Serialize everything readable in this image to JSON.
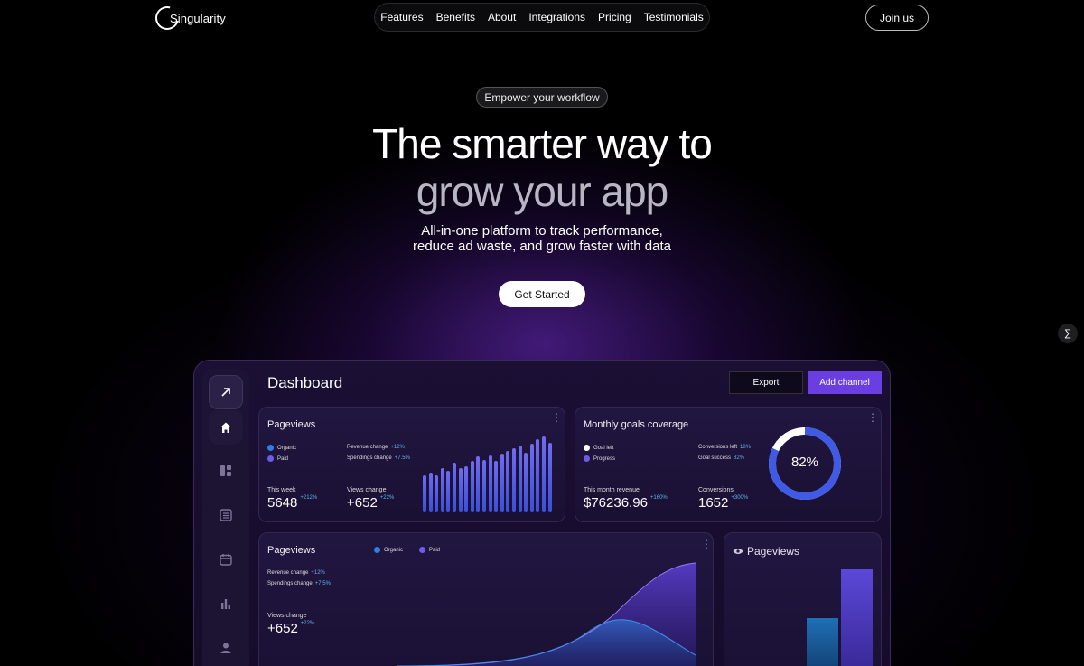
{
  "brand": {
    "name": "Singularity"
  },
  "nav": {
    "items": [
      "Features",
      "Benefits",
      "About",
      "Integrations",
      "Pricing",
      "Testimonials"
    ],
    "join_label": "Join us"
  },
  "hero": {
    "badge": "Empower your workflow",
    "title_line1": "The smarter way to",
    "title_line2": "grow your app",
    "subtitle_line1": "All-in-one platform to track performance,",
    "subtitle_line2": "reduce ad waste, and grow faster with data",
    "cta_label": "Get Started"
  },
  "framer_badge": "∑",
  "dashboard": {
    "title": "Dashboard",
    "export_label": "Export",
    "add_channel_label": "Add channel",
    "sidebar_icons": [
      "arrow-up-right-icon",
      "home-icon",
      "layout-icon",
      "table-icon",
      "calendar-icon",
      "bar-chart-icon",
      "user-icon"
    ],
    "pageviews_card": {
      "title": "Pageviews",
      "legend": [
        {
          "name": "Organic",
          "color": "#2f7fe0"
        },
        {
          "name": "Paid",
          "color": "#6c5ce7"
        }
      ],
      "revenue_change_label": "Revenue change",
      "revenue_change": "+12%",
      "spendings_change_label": "Spendings change",
      "spendings_change": "+7.5%",
      "this_week_label": "This week",
      "this_week_value": "5648",
      "this_week_change": "+212%",
      "views_change_label": "Views change",
      "views_change_value": "+652",
      "views_change_change": "+22%"
    },
    "goals_card": {
      "title": "Monthly goals coverage",
      "legend": [
        {
          "name": "Goal left",
          "color": "#ffffff"
        },
        {
          "name": "Progress",
          "color": "#6c5ce7"
        }
      ],
      "conversions_left_label": "Conversions left",
      "conversions_left": "18%",
      "goal_success_label": "Goal success",
      "goal_success": "82%",
      "revenue_label": "This month revenue",
      "revenue_value": "$76236.96",
      "revenue_change": "+160%",
      "conversions_label": "Conversions",
      "conversions_value": "1652",
      "conversions_change": "+300%",
      "donut_value": "82%",
      "donut_fraction": 0.82
    },
    "pageviews_card2": {
      "title": "Pageviews",
      "legend": [
        {
          "name": "Organic",
          "color": "#2f7fe0"
        },
        {
          "name": "Paid",
          "color": "#6c5ce7"
        }
      ],
      "revenue_change_label": "Revenue change",
      "revenue_change": "+12%",
      "spendings_change_label": "Spendings change",
      "spendings_change": "+7.5%",
      "views_change_label": "Views change",
      "views_change_value": "+652",
      "views_change_change": "+22%"
    },
    "pageviews_card3": {
      "title": "Pageviews"
    }
  },
  "chart_data": [
    {
      "type": "bar",
      "values": [
        26,
        28,
        26,
        31,
        29,
        35,
        31,
        32,
        36,
        39,
        37,
        40,
        36,
        41,
        43,
        45,
        47,
        42,
        48,
        51,
        53,
        49
      ],
      "title": "Pageviews"
    },
    {
      "type": "pie",
      "values": [
        82,
        18
      ],
      "labels": [
        "Progress",
        "Goal left"
      ],
      "title": "Monthly goals coverage"
    },
    {
      "type": "bar",
      "values": [
        30,
        60
      ],
      "title": "Pageviews"
    }
  ]
}
